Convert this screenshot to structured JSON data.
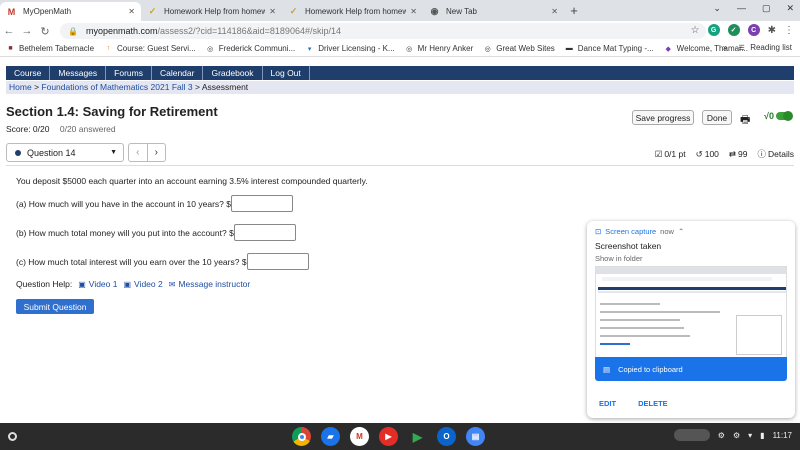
{
  "browser": {
    "tabs": [
      {
        "label": "MyOpenMath",
        "icon": "M",
        "color": "#c0392b",
        "active": true
      },
      {
        "label": "Homework Help from homework",
        "icon": "✓",
        "color": "#c9a227"
      },
      {
        "label": "Homework Help from homework",
        "icon": "✓",
        "color": "#c9a227"
      },
      {
        "label": "New Tab",
        "icon": "◉",
        "color": "#555"
      }
    ],
    "url_host": "myopenmath.com",
    "url_path": "/assess2/?cid=114186&aid=8189064#/skip/14",
    "bookmarks": [
      "Bethelem Tabernacle",
      "Course: Guest Servi...",
      "Frederick Communi...",
      "Driver Licensing - K...",
      "Mr Henry Anker",
      "Great Web Sites",
      "Dance Mat Typing -...",
      "Welcome, Thamar..."
    ],
    "reading_list": "Reading list"
  },
  "site": {
    "nav": [
      "Course",
      "Messages",
      "Forums",
      "Calendar",
      "Gradebook",
      "Log Out"
    ],
    "breadcrumb": {
      "home": "Home",
      "course": "Foundations of Mathematics 2021 Fall 3",
      "current": "Assessment",
      "sep": ">"
    }
  },
  "assessment": {
    "title": "Section 1.4: Saving for Retirement",
    "score": "Score: 0/20",
    "answered": "0/20 answered",
    "save_label": "Save progress",
    "done_label": "Done",
    "calc_label": "√0",
    "question_select": "Question 14",
    "points": "0/1 pt",
    "retries": "100",
    "attempts": "99",
    "details": "Details"
  },
  "question": {
    "intro": "You deposit $5000 each quarter into an account earning 3.5% interest compounded quarterly.",
    "parts": [
      {
        "text": "(a) How much will you have in the account in 10 years? $",
        "value": ""
      },
      {
        "text": "(b) How much total money will you put into the account? $",
        "value": ""
      },
      {
        "text": "(c) How much total interest will you earn over the 10 years? $",
        "value": ""
      }
    ],
    "help_label": "Question Help:",
    "video1": "Video 1",
    "video2": "Video 2",
    "message": "Message instructor",
    "submit": "Submit Question"
  },
  "notification": {
    "app": "Screen capture",
    "time": "now",
    "title": "Screenshot taken",
    "subtitle": "Show in folder",
    "copied": "Copied to clipboard",
    "edit": "EDIT",
    "delete": "DELETE"
  },
  "shelf": {
    "time": "11:17"
  }
}
